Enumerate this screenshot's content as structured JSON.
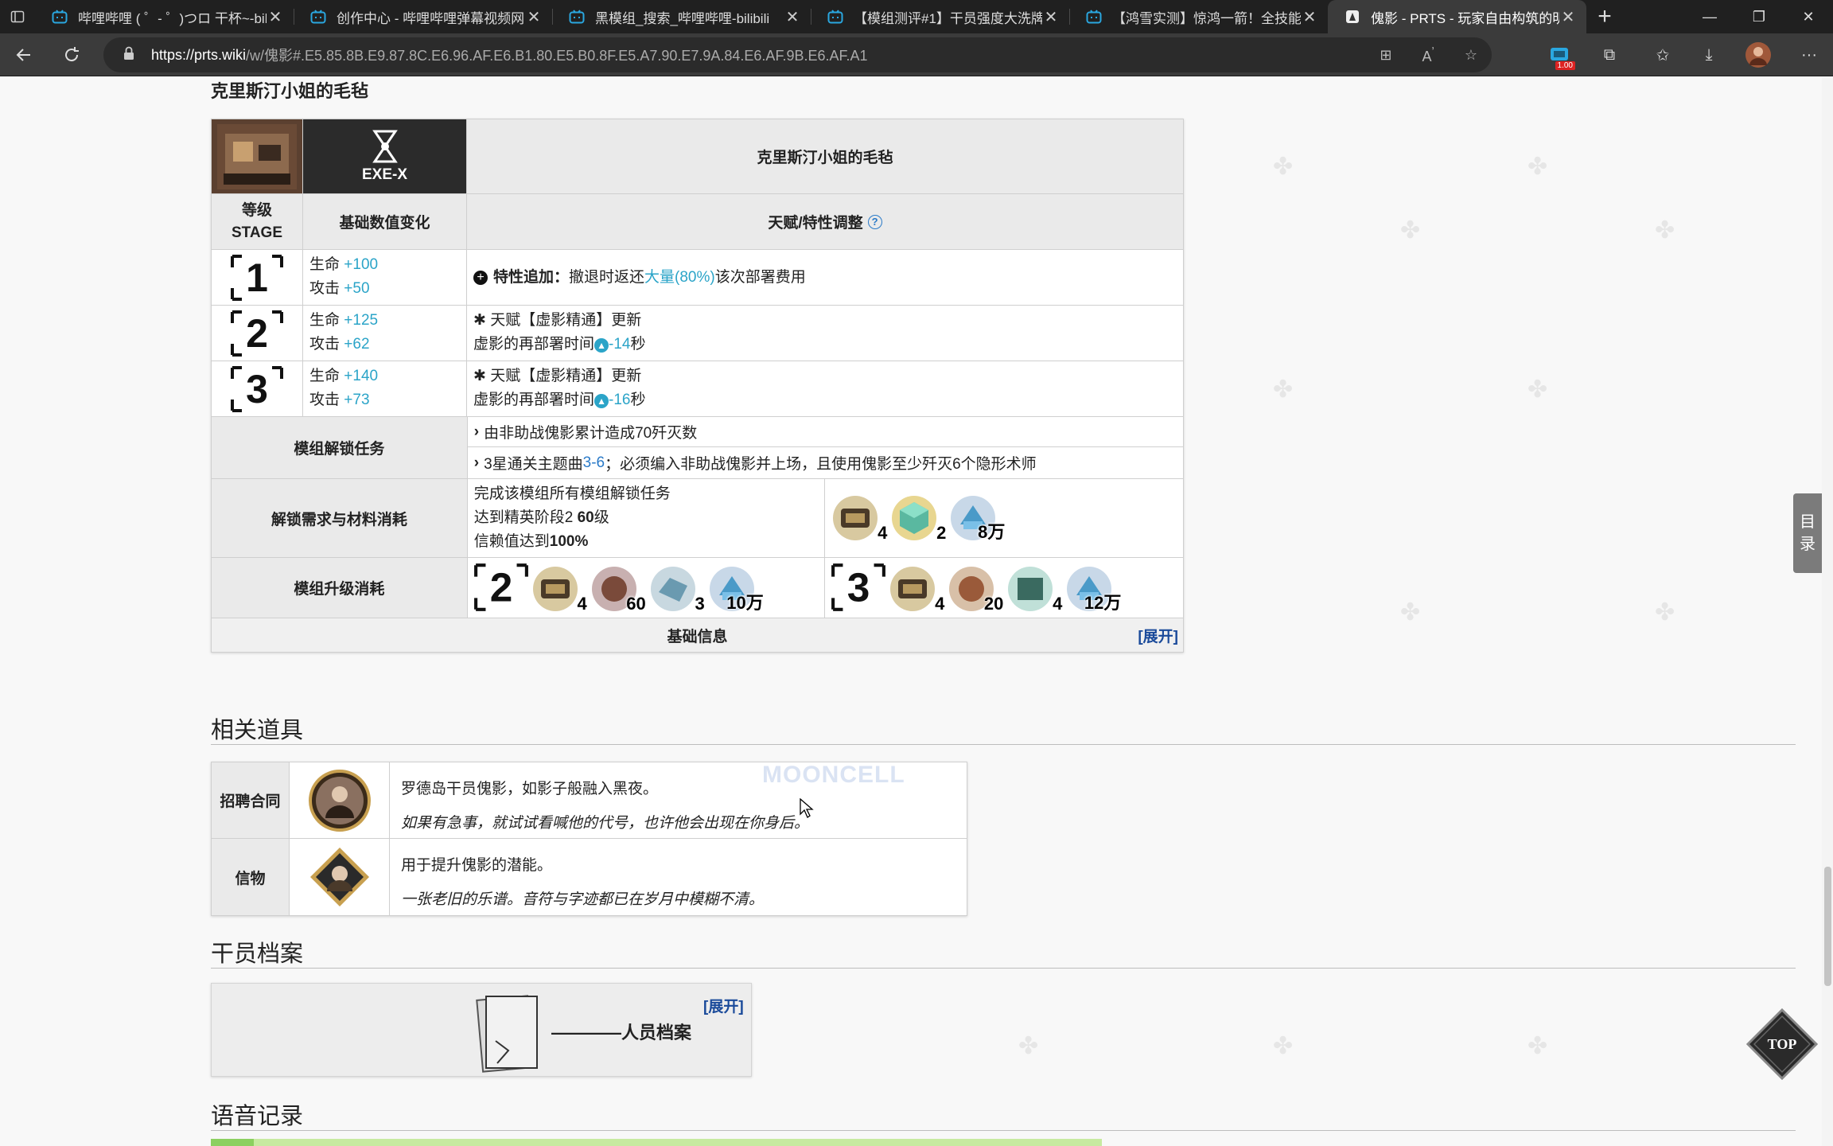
{
  "browser": {
    "tabs": [
      {
        "title": "哔哩哔哩 ( ゜- ゜)つロ 干杯~-bilit",
        "active": false
      },
      {
        "title": "创作中心 - 哔哩哔哩弹幕视频网",
        "active": false
      },
      {
        "title": "黑模组_搜索_哔哩哔哩-bilibili",
        "active": false
      },
      {
        "title": "【模组测评#1】干员强度大洗牌",
        "active": false
      },
      {
        "title": "【鸿雪实测】惊鸿一箭！全技能",
        "active": false
      },
      {
        "title": "傀影 - PRTS - 玩家自由构筑的明",
        "active": true
      }
    ],
    "url_host": "https://prts.wiki",
    "url_path": "/w/傀影#.E5.85.8B.E9.87.8C.E6.96.AF.E6.B1.80.E5.B0.8F.E5.A7.90.E7.9A.84.E6.AF.9B.E6.AF.A1",
    "ext_badge": "1.00"
  },
  "module": {
    "heading": "克里斯汀小姐的毛毡",
    "type_code": "EXE-X",
    "name": "克里斯汀小姐的毛毡",
    "col_stage": "等级\nSTAGE",
    "col_stage_a": "等级",
    "col_stage_b": "STAGE",
    "col_stats": "基础数值变化",
    "col_talent": "天赋/特性调整",
    "stages": [
      {
        "no": "1",
        "hp_label": "生命",
        "hp": "+100",
        "atk_label": "攻击",
        "atk": "+50",
        "line1_pre": "特性追加：",
        "line1_a": "撤退时返还",
        "line1_hl": "大量(80%)",
        "line1_b": "该次部署费用",
        "line2": ""
      },
      {
        "no": "2",
        "hp_label": "生命",
        "hp": "+125",
        "atk_label": "攻击",
        "atk": "+62",
        "line1_pre": "",
        "line1_a": "天赋【虚影精通】更新",
        "line1_hl": "",
        "line1_b": "",
        "line2_a": "虚影的再部署时间",
        "line2_hl": "-14",
        "line2_b": "秒"
      },
      {
        "no": "3",
        "hp_label": "生命",
        "hp": "+140",
        "atk_label": "攻击",
        "atk": "+73",
        "line1_pre": "",
        "line1_a": "天赋【虚影精通】更新",
        "line1_hl": "",
        "line1_b": "",
        "line2_a": "虚影的再部署时间",
        "line2_hl": "-16",
        "line2_b": "秒"
      }
    ],
    "unlock_task_label": "模组解锁任务",
    "task1": "由非助战傀影累计造成70歼灭数",
    "task2_a": "3星通关主题曲",
    "task2_hl": "3-6",
    "task2_b": "；必须编入非助战傀影并上场，且使用傀影至少歼灭6个隐形术师",
    "req_label": "解锁需求与材料消耗",
    "req1": "完成该模组所有模组解锁任务",
    "req2_a": "达到精英阶段2 ",
    "req2_b": "60",
    "req2_c": "级",
    "req3_a": "信赖值达到",
    "req3_b": "100%",
    "req_items": [
      "4",
      "2",
      "8万"
    ],
    "upgrade_label": "模组升级消耗",
    "up2_items": [
      "4",
      "60",
      "3",
      "10万"
    ],
    "up3_items": [
      "4",
      "20",
      "4",
      "12万"
    ],
    "base_info": "基础信息",
    "expand": "[展开]"
  },
  "related": {
    "heading": "相关道具",
    "rows": [
      {
        "label": "招聘合同",
        "line1": "罗德岛干员傀影，如影子般融入黑夜。",
        "line2": "如果有急事，就试试看喊他的代号，也许他会出现在你身后。"
      },
      {
        "label": "信物",
        "line1": "用于提升傀影的潜能。",
        "line2": "一张老旧的乐谱。音符与字迹都已在岁月中模糊不清。"
      }
    ]
  },
  "archive": {
    "heading": "干员档案",
    "title": "————人员档案",
    "expand": "[展开]"
  },
  "voice": {
    "heading": "语音记录"
  },
  "toc": {
    "a": "目",
    "b": "录"
  },
  "top_label": "TOP",
  "watermark": "MOONCELL"
}
